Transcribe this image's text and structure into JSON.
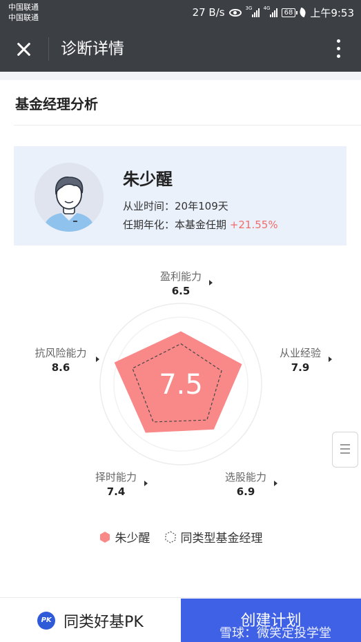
{
  "status_bar": {
    "carrier1": "中国联通",
    "carrier2": "中国联通",
    "speed": "27 B/s",
    "net1": "3G",
    "net2": "4G",
    "battery": "68",
    "time": "上午9:53"
  },
  "title_bar": {
    "title": "诊断详情"
  },
  "section": {
    "title": "基金经理分析"
  },
  "manager": {
    "name": "朱少醒",
    "tenure_label": "从业时间：",
    "tenure_value": "20年109天",
    "annual_label": "任期年化：",
    "annual_text": "本基金任期",
    "annual_value": "+21.55%"
  },
  "chart_data": {
    "type": "radar",
    "center_score": "7.5",
    "axes": [
      "盈利能力",
      "从业经验",
      "选股能力",
      "择时能力",
      "抗风险能力"
    ],
    "max": 10,
    "series": [
      {
        "name": "朱少醒",
        "values": [
          6.5,
          7.9,
          6.9,
          7.4,
          8.6
        ],
        "color": "#f98989",
        "style": "filled"
      },
      {
        "name": "同类型基金经理",
        "values": [
          5.0,
          5.3,
          5.5,
          5.8,
          6.3
        ],
        "color": "#444444",
        "style": "dashed"
      }
    ]
  },
  "labels": {
    "profit": {
      "name": "盈利能力",
      "value": "6.5"
    },
    "experience": {
      "name": "从业经验",
      "value": "7.9"
    },
    "stock_pick": {
      "name": "选股能力",
      "value": "6.9"
    },
    "timing": {
      "name": "择时能力",
      "value": "7.4"
    },
    "risk": {
      "name": "抗风险能力",
      "value": "8.6"
    }
  },
  "legend": {
    "item1": "朱少醒",
    "item2": "同类型基金经理"
  },
  "bottom_bar": {
    "pk_badge": "PK",
    "pk_label": "同类好基PK",
    "create_label": "创建计划",
    "watermark": "雪球：微笑定投学堂"
  },
  "colors": {
    "accent": "#3f61e6",
    "radar_fill": "#f98989",
    "positive": "#f26b6b",
    "card_bg": "#eaf1fb"
  }
}
